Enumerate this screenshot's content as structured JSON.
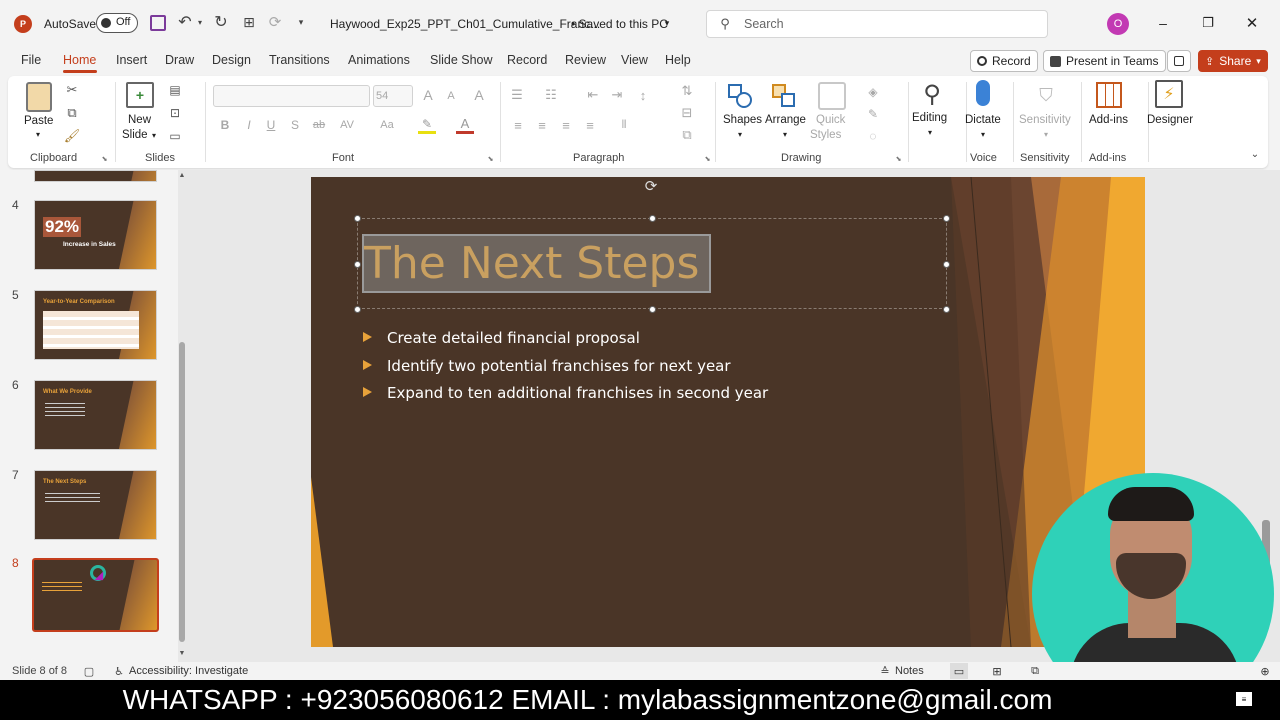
{
  "titlebar": {
    "autosave_label": "AutoSave",
    "autosave_state": "Off",
    "filename": "Haywood_Exp25_PPT_Ch01_Cumulative_Franc...",
    "save_status": "• Saved to this PC",
    "search_placeholder": "Search",
    "avatar_initial": "O"
  },
  "menu_tabs": [
    "File",
    "Home",
    "Insert",
    "Draw",
    "Design",
    "Transitions",
    "Animations",
    "Slide Show",
    "Record",
    "Review",
    "View",
    "Help"
  ],
  "menu_active": "Home",
  "right_buttons": {
    "record": "Record",
    "present": "Present in Teams",
    "share": "Share"
  },
  "ribbon": {
    "paste": "Paste",
    "new_slide_1": "New",
    "new_slide_2": "Slide",
    "font_size": "54",
    "shapes": "Shapes",
    "arrange": "Arrange",
    "quick_styles_1": "Quick",
    "quick_styles_2": "Styles",
    "editing": "Editing",
    "dictate": "Dictate",
    "sensitivity": "Sensitivity",
    "addins": "Add-ins",
    "designer": "Designer",
    "groups": {
      "clipboard": "Clipboard",
      "slides": "Slides",
      "font": "Font",
      "paragraph": "Paragraph",
      "drawing": "Drawing",
      "voice": "Voice",
      "sensitivity": "Sensitivity",
      "addins": "Add-ins"
    }
  },
  "thumbnails": [
    {
      "num": "4",
      "text": "92%",
      "sub": "Increase in Sales"
    },
    {
      "num": "5",
      "text": "Year-to-Year Comparison"
    },
    {
      "num": "6",
      "text": "What We Provide"
    },
    {
      "num": "7",
      "text": "The Next Steps"
    },
    {
      "num": "8",
      "text": ""
    }
  ],
  "slide": {
    "title": "The Next Steps",
    "bullets": [
      "Create detailed financial proposal",
      "Identify two potential franchises for next year",
      "Expand to ten additional franchises in second year"
    ]
  },
  "status": {
    "slide_count": "Slide 8 of 8",
    "accessibility": "Accessibility: Investigate",
    "notes": "Notes"
  },
  "banner": "WHATSAPP : +923056080612 EMAIL : mylabassignmentzone@gmail.com",
  "colors": {
    "accent": "#c43e1c",
    "slide_bg": "#4a3527",
    "title_color": "#c9a060",
    "bullet_arrow": "#e8a23a"
  }
}
